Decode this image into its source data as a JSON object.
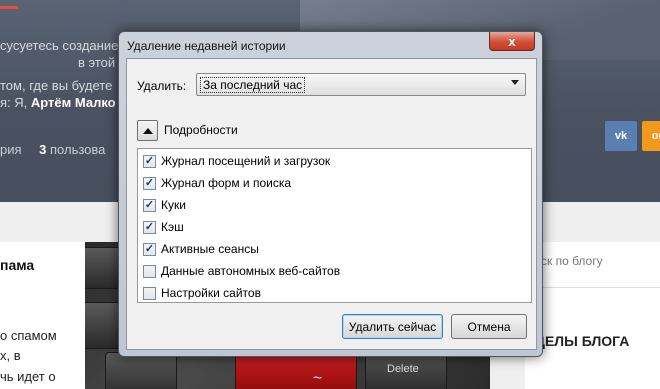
{
  "background_page": {
    "lines": [
      "сусуетесь создание",
      "в этой области?",
      "том, где вы будете",
      "я: Я,"
    ],
    "author": "Артём Малко",
    "stats_label": "рия",
    "users_count": "3",
    "users_label": "пользова",
    "social": {
      "vk": "vk",
      "ok": "ок"
    },
    "post_title": "пама",
    "post_lines": [
      "о спамом",
      "х, в",
      "чь идет о"
    ],
    "keys": [
      "Delete",
      "~"
    ],
    "sidebar_search": "ск по блогу",
    "sidebar_heading": "ДЕЛЫ БЛОГА"
  },
  "dialog": {
    "title": "Удаление недавней истории",
    "close_symbol": "x",
    "time_range_label": "Удалить:",
    "time_range_value": "За последний час",
    "details_label": "Подробности",
    "items": [
      {
        "label": "Журнал посещений и загрузок",
        "checked": true
      },
      {
        "label": "Журнал форм и поиска",
        "checked": true
      },
      {
        "label": "Куки",
        "checked": true
      },
      {
        "label": "Кэш",
        "checked": true
      },
      {
        "label": "Активные сеансы",
        "checked": true
      },
      {
        "label": "Данные автономных веб-сайтов",
        "checked": false
      },
      {
        "label": "Настройки сайтов",
        "checked": false
      }
    ],
    "clear_button": "Удалить сейчас",
    "cancel_button": "Отмена"
  },
  "check_mark": "✓"
}
